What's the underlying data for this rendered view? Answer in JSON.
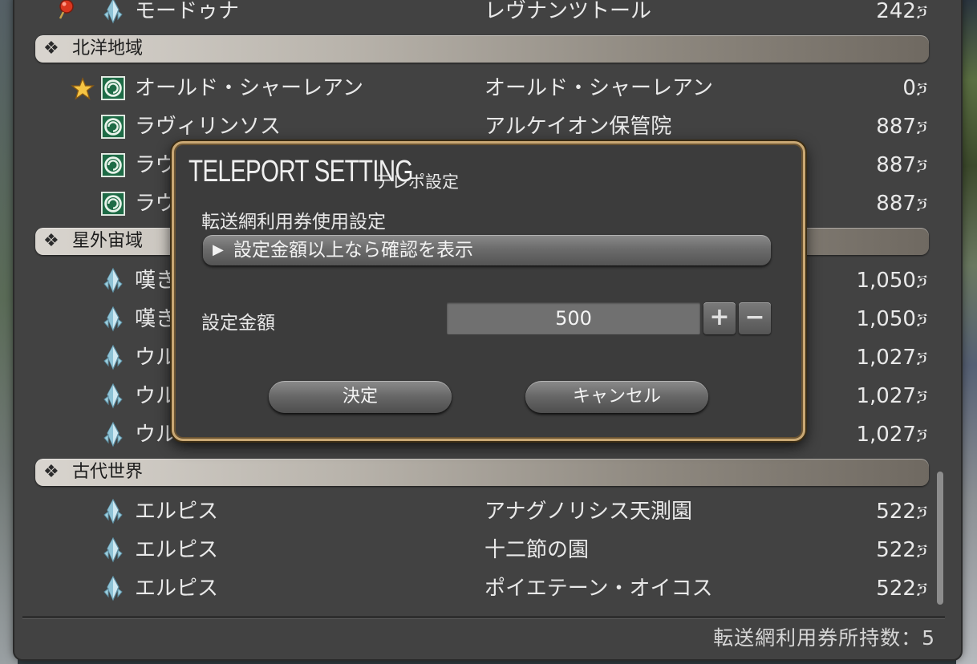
{
  "list": {
    "rows_top": [
      {
        "marker": "map-pin",
        "icon": "aetheryte-crystal",
        "name": "モードゥナ",
        "place": "レヴナンツトール",
        "cost": "242"
      },
      {
        "section": "北洋地域"
      },
      {
        "marker": "favorite-star",
        "icon": "aethernet-shard",
        "name": "オールド・シャーレアン",
        "place": "オールド・シャーレアン",
        "cost": "0"
      },
      {
        "icon": "aethernet-shard",
        "name": "ラヴィリンソス",
        "place": "アルケイオン保管院",
        "cost": "887"
      },
      {
        "icon": "aethernet-shard",
        "name": "ラヴ",
        "place": "",
        "cost": "887"
      },
      {
        "icon": "aethernet-shard",
        "name": "ラヴ",
        "place": "",
        "cost": "887"
      },
      {
        "section": "星外宙域"
      },
      {
        "icon": "aetheryte-crystal",
        "name": "嘆き",
        "place": "",
        "cost": "1,050"
      },
      {
        "icon": "aetheryte-crystal",
        "name": "嘆き",
        "place": "",
        "cost": "1,050"
      },
      {
        "icon": "aetheryte-crystal",
        "name": "ウル",
        "place": "",
        "cost": "1,027"
      },
      {
        "icon": "aetheryte-crystal",
        "name": "ウル",
        "place": "",
        "cost": "1,027"
      },
      {
        "icon": "aetheryte-crystal",
        "name": "ウル",
        "place": "",
        "cost": "1,027"
      },
      {
        "section": "古代世界"
      },
      {
        "icon": "aetheryte-crystal",
        "name": "エルピス",
        "place": "アナグノリシス天測園",
        "cost": "522"
      },
      {
        "icon": "aetheryte-crystal",
        "name": "エルピス",
        "place": "十二節の園",
        "cost": "522"
      },
      {
        "icon": "aetheryte-crystal",
        "name": "エルピス",
        "place": "ポイエテーン・オイコス",
        "cost": "522"
      }
    ],
    "currency_symbol": "ጛ",
    "footer": "転送網利用券所持数：5"
  },
  "dialog": {
    "title_en": "TELEPORT SETTING",
    "title_jp": "テレポ設定",
    "section_label": "転送網利用券使用設定",
    "select_value": "設定金額以上なら確認を表示",
    "amount_label": "設定金額",
    "amount_value": "500",
    "plus": "+",
    "minus": "−",
    "confirm": "決定",
    "cancel": "キャンセル"
  },
  "colors": {
    "window_bg": "#424242",
    "dialog_border": "#c9a874",
    "section_bar_light": "#d9d5cf",
    "section_bar_dark": "#6f6961",
    "text": "#e9e9e9"
  }
}
